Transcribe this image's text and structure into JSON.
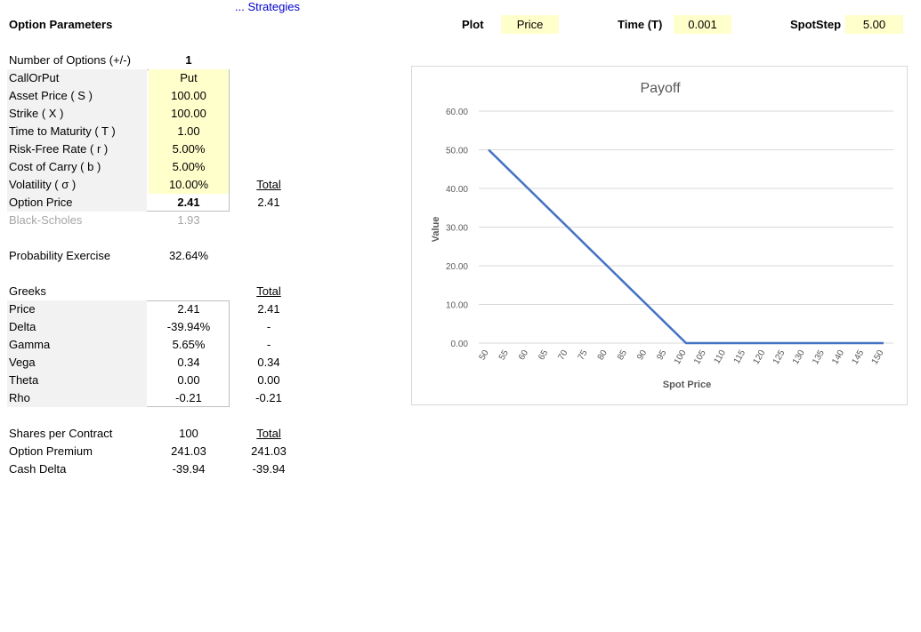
{
  "header": {
    "strategies_link": "... Strategies",
    "title": "Option Parameters",
    "plot_label": "Plot",
    "plot_value": "Price",
    "time_label": "Time (T)",
    "time_value": "0.001",
    "spotstep_label": "SpotStep",
    "spotstep_value": "5.00"
  },
  "params": {
    "num_options_label": "Number of Options (+/-)",
    "num_options_value": "1",
    "rows": [
      {
        "label": "CallOrPut",
        "value": "Put"
      },
      {
        "label": "Asset Price ( S )",
        "value": "100.00"
      },
      {
        "label": "Strike ( X )",
        "value": "100.00"
      },
      {
        "label": "Time to Maturity ( T )",
        "value": "1.00"
      },
      {
        "label": "Risk-Free Rate ( r )",
        "value": "5.00%"
      },
      {
        "label": "Cost of Carry ( b )",
        "value": "5.00%"
      },
      {
        "label": "Volatility ( σ )",
        "value": "10.00%"
      }
    ],
    "total_header": "Total",
    "option_price_label": "Option Price",
    "option_price_value": "2.41",
    "option_price_total": "2.41",
    "black_scholes_label": "Black-Scholes",
    "black_scholes_value": "1.93"
  },
  "probability": {
    "label": "Probability Exercise",
    "value": "32.64%"
  },
  "greeks": {
    "header": "Greeks",
    "total_header": "Total",
    "rows": [
      {
        "label": "Price",
        "value": "2.41",
        "total": "2.41"
      },
      {
        "label": "Delta",
        "value": "-39.94%",
        "total": "-"
      },
      {
        "label": "Gamma",
        "value": "5.65%",
        "total": "-"
      },
      {
        "label": "Vega",
        "value": "0.34",
        "total": "0.34"
      },
      {
        "label": "Theta",
        "value": "0.00",
        "total": "0.00"
      },
      {
        "label": "Rho",
        "value": "-0.21",
        "total": "-0.21"
      }
    ]
  },
  "contract": {
    "total_header": "Total",
    "rows": [
      {
        "label": "Shares per Contract",
        "value": "100",
        "total": ""
      },
      {
        "label": "Option Premium",
        "value": "241.03",
        "total": "241.03"
      },
      {
        "label": "Cash Delta",
        "value": "-39.94",
        "total": "-39.94"
      }
    ]
  },
  "colors": {
    "input_fill": "#ffffcc",
    "label_fill": "#f2f2f2",
    "link": "#0000cc",
    "series_line": "#4472c4"
  },
  "chart_data": {
    "type": "line",
    "title": "Payoff",
    "xlabel": "Spot Price",
    "ylabel": "Value",
    "ylim": [
      0,
      60
    ],
    "yticks": [
      "0.00",
      "10.00",
      "20.00",
      "30.00",
      "40.00",
      "50.00",
      "60.00"
    ],
    "grid": true,
    "categories": [
      "50",
      "55",
      "60",
      "65",
      "70",
      "75",
      "80",
      "85",
      "90",
      "95",
      "100",
      "105",
      "110",
      "115",
      "120",
      "125",
      "130",
      "135",
      "140",
      "145",
      "150"
    ],
    "series": [
      {
        "values": [
          50,
          45,
          40,
          35,
          30,
          25,
          20,
          15,
          10,
          5,
          0,
          0,
          0,
          0,
          0,
          0,
          0,
          0,
          0,
          0,
          0
        ]
      }
    ]
  }
}
